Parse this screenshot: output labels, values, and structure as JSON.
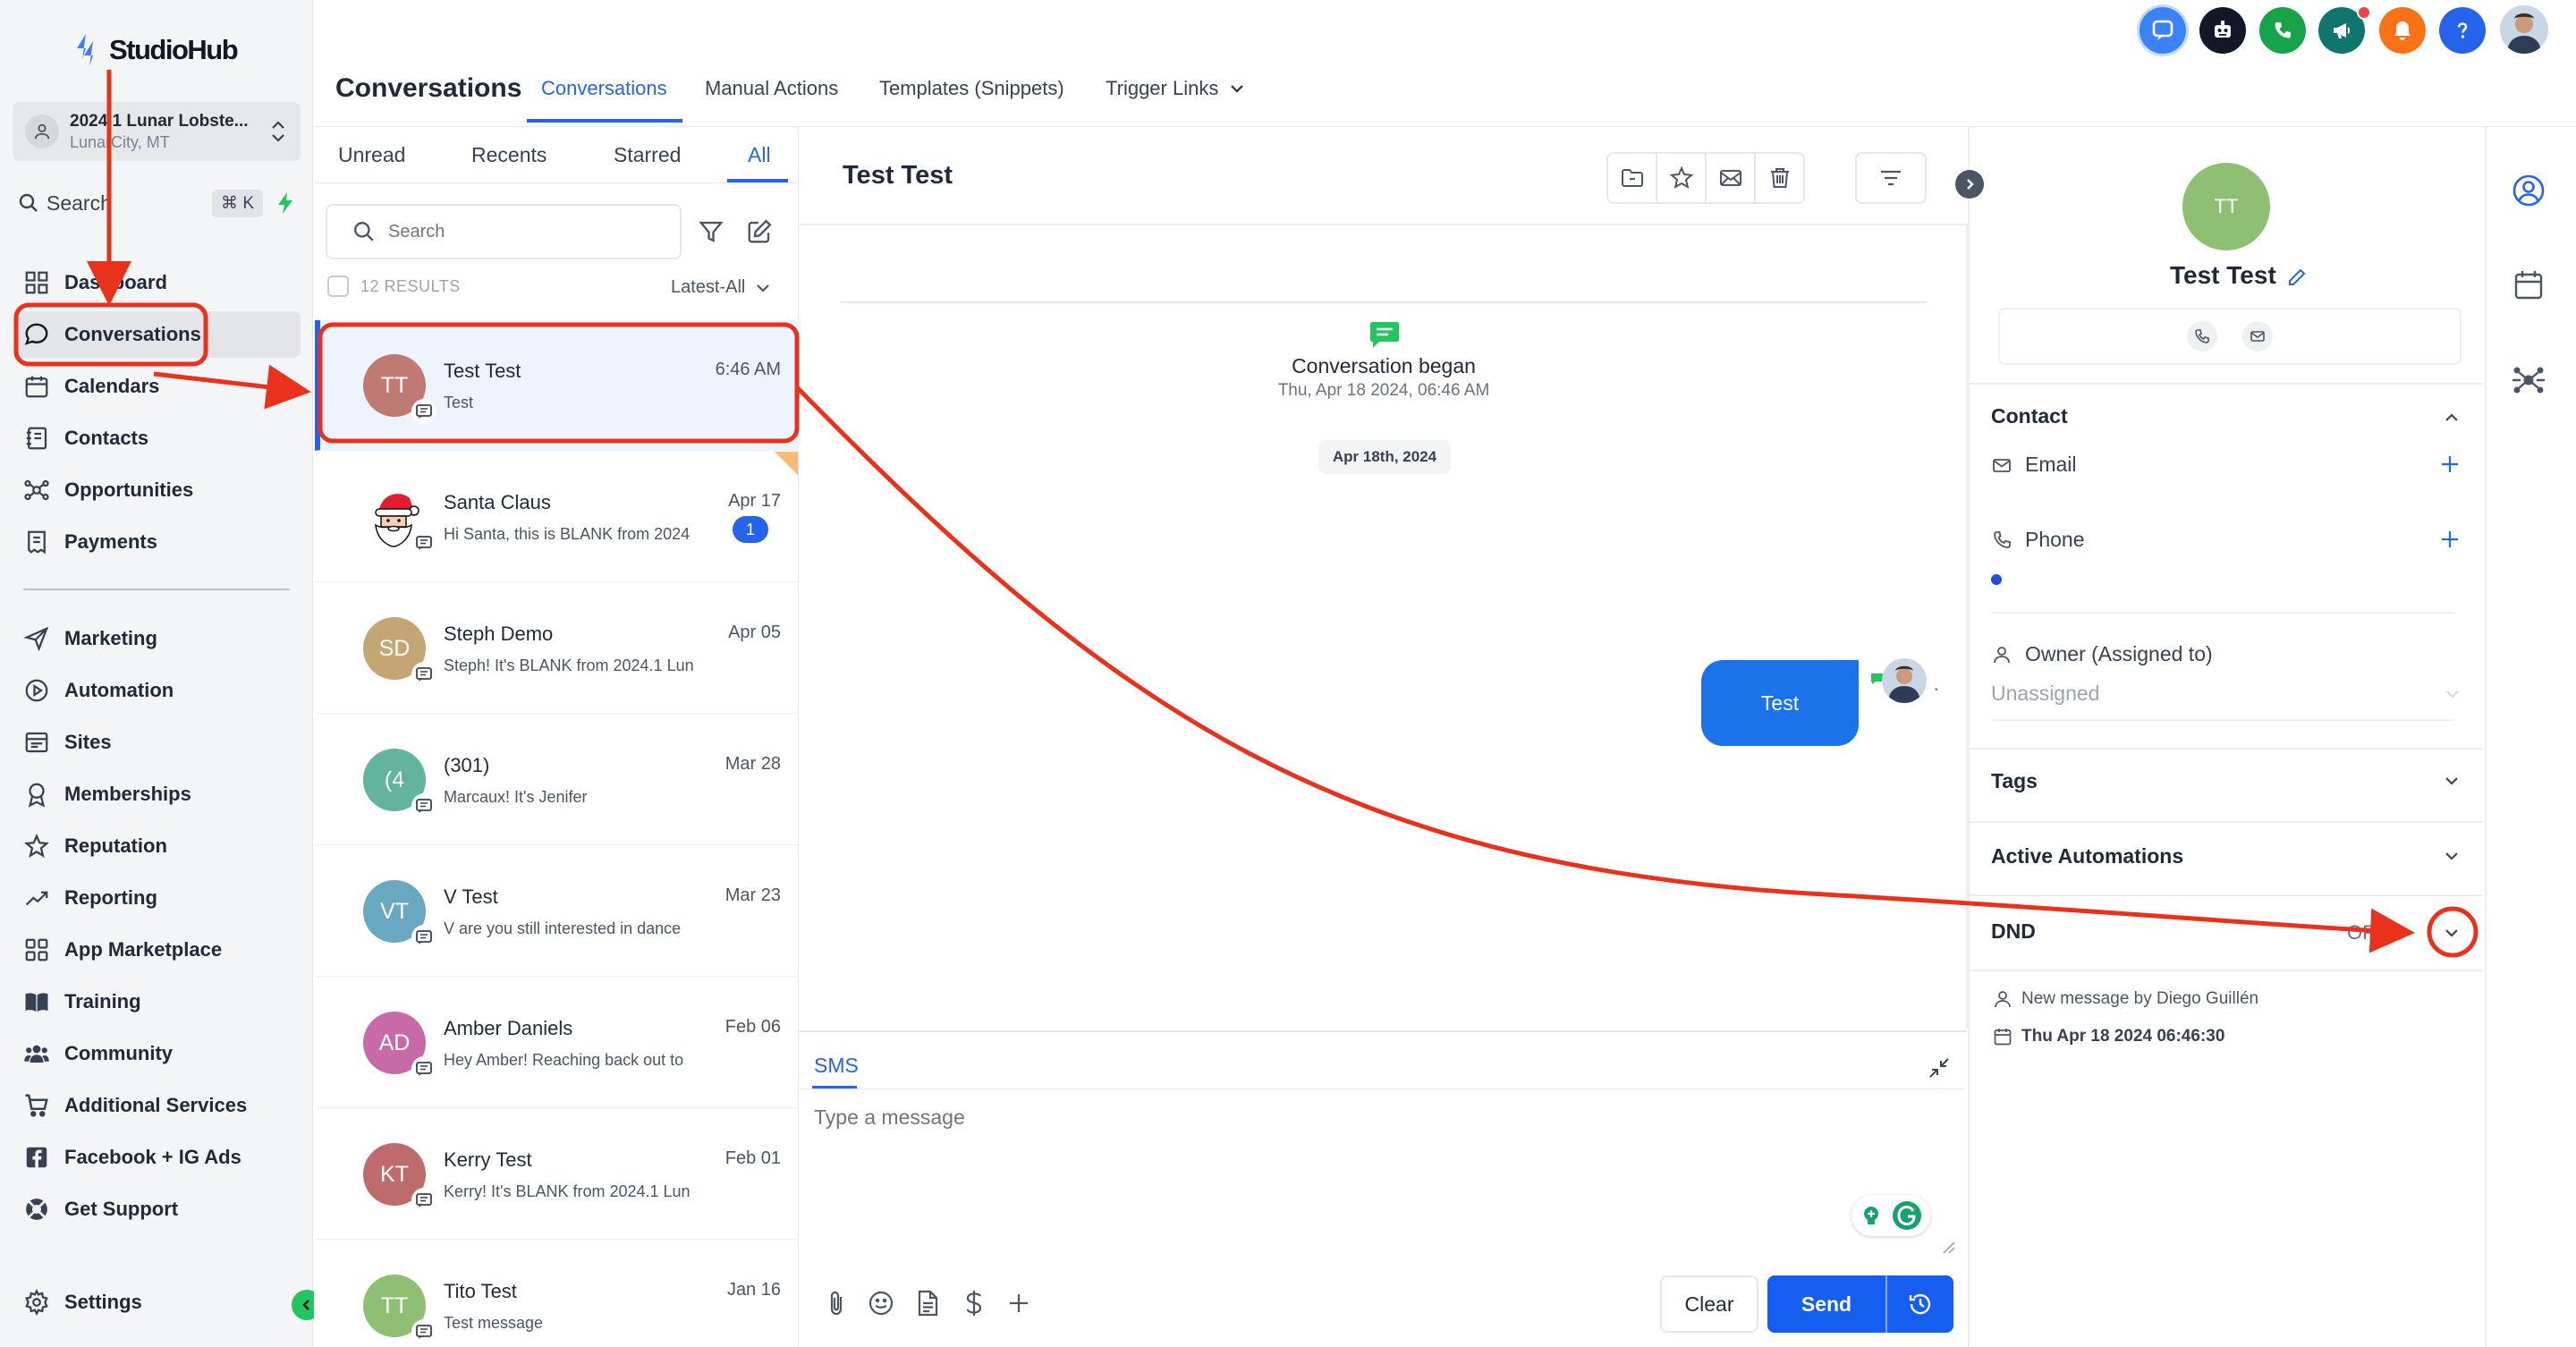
{
  "brand": {
    "name": "StudioHub"
  },
  "location": {
    "name": "2024.1 Lunar Lobste...",
    "city": "LunarCity, MT"
  },
  "sidebar": {
    "search_label": "Search",
    "search_shortcut": "⌘ K",
    "items": [
      {
        "label": "Dashboard",
        "icon": "grid-icon"
      },
      {
        "label": "Conversations",
        "icon": "chat-bubble-icon"
      },
      {
        "label": "Calendars",
        "icon": "calendar-icon"
      },
      {
        "label": "Contacts",
        "icon": "contacts-book-icon"
      },
      {
        "label": "Opportunities",
        "icon": "network-icon"
      },
      {
        "label": "Payments",
        "icon": "receipt-icon"
      },
      {
        "label": "Marketing",
        "icon": "send-icon"
      },
      {
        "label": "Automation",
        "icon": "play-circle-icon"
      },
      {
        "label": "Sites",
        "icon": "browser-window-icon"
      },
      {
        "label": "Memberships",
        "icon": "award-icon"
      },
      {
        "label": "Reputation",
        "icon": "star-icon"
      },
      {
        "label": "Reporting",
        "icon": "trend-line-icon"
      },
      {
        "label": "App Marketplace",
        "icon": "apps-grid-icon"
      },
      {
        "label": "Training",
        "icon": "book-icon"
      },
      {
        "label": "Community",
        "icon": "users-icon"
      },
      {
        "label": "Additional Services",
        "icon": "cart-icon"
      },
      {
        "label": "Facebook + IG Ads",
        "icon": "facebook-icon"
      },
      {
        "label": "Get Support",
        "icon": "lifebuoy-icon"
      }
    ],
    "settings_label": "Settings"
  },
  "header": {
    "title": "Conversations",
    "tabs": [
      "Conversations",
      "Manual Actions",
      "Templates (Snippets)",
      "Trigger Links"
    ],
    "active_tab": "Conversations"
  },
  "top_icons": [
    "chat-widget-icon",
    "bot-icon",
    "phone-icon",
    "megaphone-icon",
    "bell-icon",
    "help-icon"
  ],
  "list": {
    "tabs": [
      "Unread",
      "Recents",
      "Starred",
      "All"
    ],
    "active_tab": "All",
    "search_placeholder": "Search",
    "results": "12 RESULTS",
    "sort": "Latest-All",
    "conversations": [
      {
        "initials": "TT",
        "name": "Test Test",
        "preview": "Test",
        "time": "6:46 AM",
        "color": "#c07a74",
        "selected": true
      },
      {
        "initials": "",
        "name": "Santa Claus",
        "preview": "Hi Santa, this is BLANK from 2024",
        "time": "Apr 17",
        "badge": "1",
        "color": "#ffffff",
        "santa": true
      },
      {
        "initials": "SD",
        "name": "Steph Demo",
        "preview": "Steph! It's BLANK from 2024.1 Lun",
        "time": "Apr 05",
        "color": "#c4a675"
      },
      {
        "initials": "(4",
        "name": "(301)",
        "preview": "Marcaux! It's Jenifer",
        "time": "Mar 28",
        "color": "#62b59b"
      },
      {
        "initials": "VT",
        "name": "V Test",
        "preview": "V are you still interested in dance",
        "time": "Mar 23",
        "color": "#6aa7c0"
      },
      {
        "initials": "AD",
        "name": "Amber Daniels",
        "preview": "Hey Amber! Reaching back out to",
        "time": "Feb 06",
        "color": "#c96aa8"
      },
      {
        "initials": "KT",
        "name": "Kerry Test",
        "preview": "Kerry! It's BLANK from 2024.1 Lun",
        "time": "Feb 01",
        "color": "#c06b6b"
      },
      {
        "initials": "TT",
        "name": "Tito Test",
        "preview": "Test message",
        "time": "Jan 16",
        "color": "#8fbf73"
      }
    ]
  },
  "chat": {
    "title": "Test Test",
    "began_title": "Conversation began",
    "began_time": "Thu, Apr 18 2024, 06:46 AM",
    "date_pill": "Apr 18th, 2024",
    "message": "Test",
    "composer_tab": "SMS",
    "placeholder": "Type a message",
    "clear": "Clear",
    "send": "Send"
  },
  "contact": {
    "initials": "TT",
    "name": "Test Test",
    "section_contact": "Contact",
    "email_label": "Email",
    "phone_label": "Phone",
    "owner_label": "Owner (Assigned to)",
    "owner_value": "Unassigned",
    "tags": "Tags",
    "active_automations": "Active Automations",
    "dnd": "DND",
    "dnd_state": "OFF",
    "meta_message": "New message by Diego Guillén",
    "meta_date": "Thu Apr 18 2024 06:46:30"
  },
  "colors": {
    "accent": "#2563eb",
    "annotation": "#e8321c",
    "sidebar_bg": "#f4f5f7"
  }
}
